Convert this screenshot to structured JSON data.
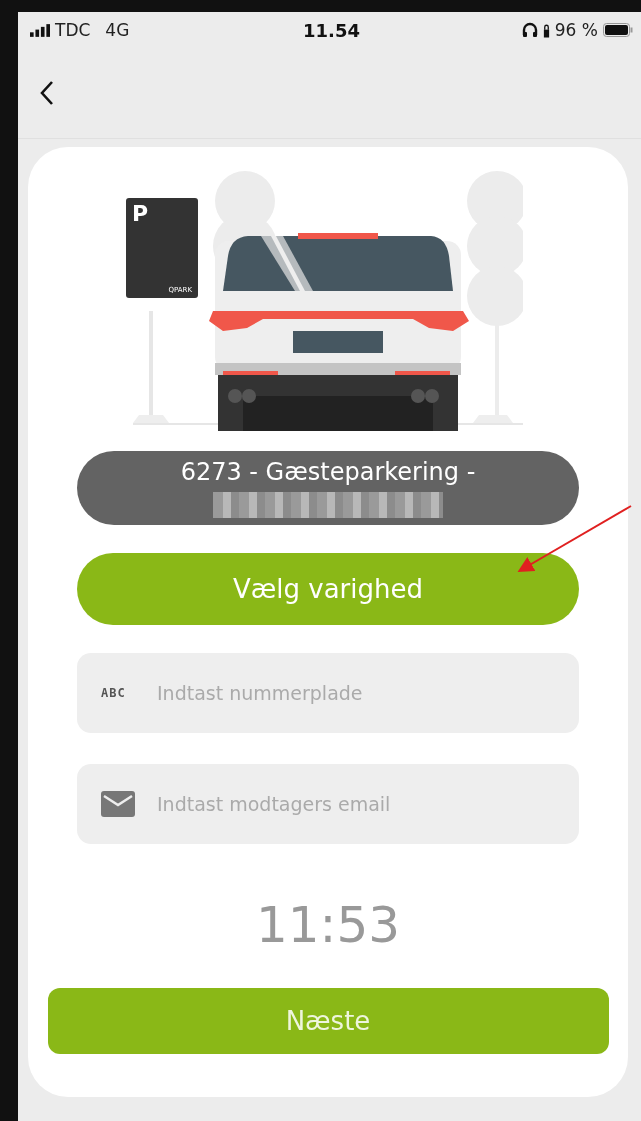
{
  "status_bar": {
    "carrier": "TDC",
    "network": "4G",
    "time": "11.54",
    "battery": "96 %"
  },
  "illustration": {
    "sign_letter": "P",
    "sign_brand": "QPARK"
  },
  "location": {
    "title": "6273 - Gæsteparkering -"
  },
  "duration_button": {
    "label": "Vælg varighed"
  },
  "fields": [
    {
      "kind": "plate",
      "icon_text": "ABC",
      "placeholder": "Indtast nummerplade"
    },
    {
      "kind": "email",
      "placeholder": "Indtast modtagers email"
    }
  ],
  "clock": "11:53",
  "next_button": {
    "label": "Næste"
  }
}
